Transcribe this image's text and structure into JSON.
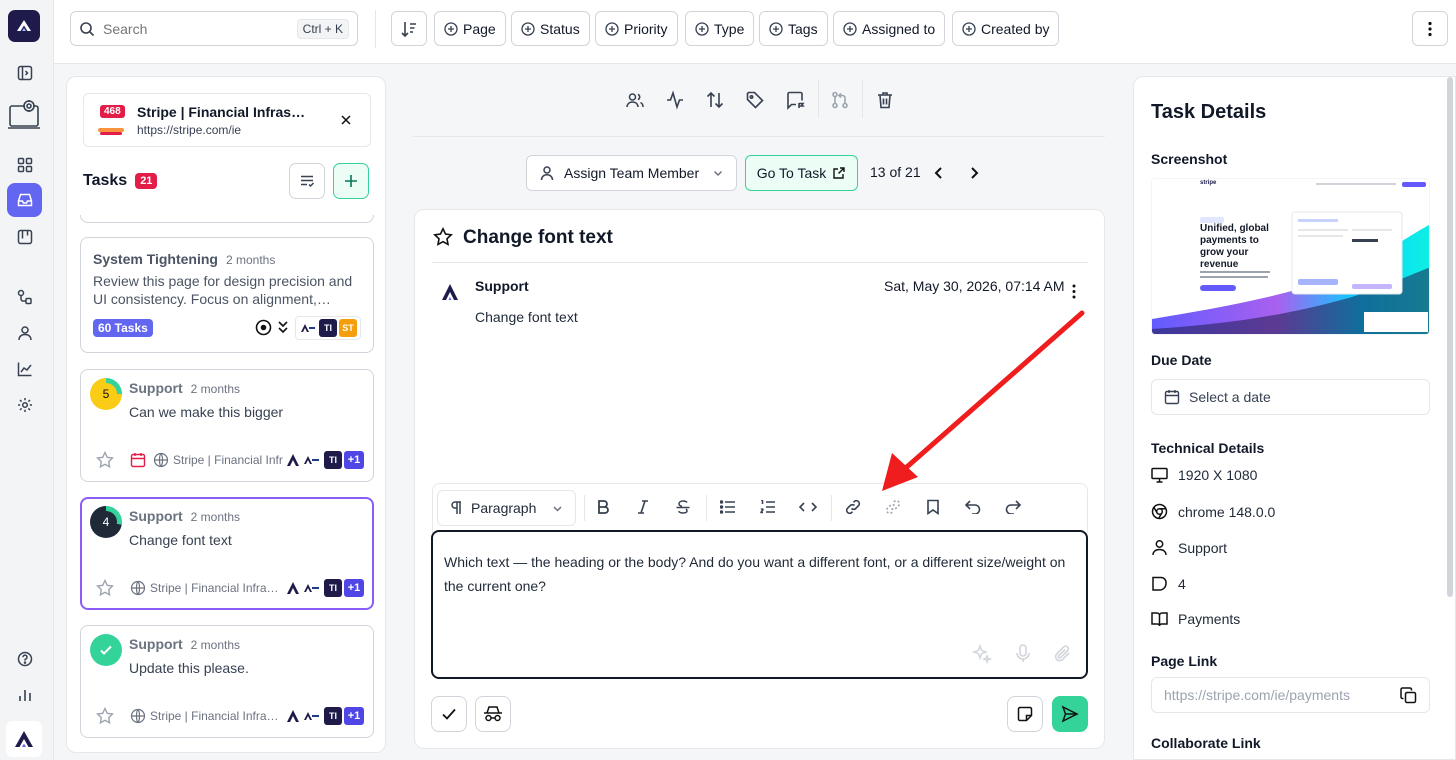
{
  "search": {
    "placeholder": "Search",
    "shortcut": "Ctrl + K"
  },
  "filters": [
    "Page",
    "Status",
    "Priority",
    "Type",
    "Tags",
    "Assigned to",
    "Created by"
  ],
  "site": {
    "badge": "468",
    "title": "Stripe | Financial Infras…",
    "url": "https://stripe.com/ie"
  },
  "tasks": {
    "label": "Tasks",
    "count": "21",
    "group": {
      "title": "System Tightening",
      "time": "2 months",
      "desc": "Review this page for design precision and UI consistency. Focus on alignment,…",
      "badge": "60 Tasks",
      "avatars": [
        "TI",
        "ST"
      ]
    },
    "items": [
      {
        "author": "Support",
        "time": "2 months",
        "text": "Can we make this bigger",
        "priority": "5",
        "site": "Stripe | Financial Infr",
        "av": "TI",
        "more": "+1"
      },
      {
        "author": "Support",
        "time": "2 months",
        "text": "Change font text",
        "priority": "4",
        "site": "Stripe | Financial Infra…",
        "av": "TI",
        "more": "+1"
      },
      {
        "author": "Support",
        "time": "2 months",
        "text": "Update this please.",
        "site": "Stripe | Financial Infra…",
        "av": "TI",
        "more": "+1"
      }
    ]
  },
  "nav": {
    "assign": "Assign Team Member",
    "goto": "Go To Task",
    "position": "13 of 21"
  },
  "task": {
    "title": "Change font text",
    "comment": {
      "author": "Support",
      "date": "Sat, May 30, 2026, 07:14 AM",
      "text": "Change font text"
    }
  },
  "editor": {
    "block_type": "Paragraph",
    "reply": "Which text — the heading or the body? And do you want a different font, or a different size/weight on the current one?"
  },
  "details": {
    "title": "Task Details",
    "screenshot_label": "Screenshot",
    "thumb": {
      "headline": "Unified, global payments to grow your revenue",
      "brand": "stripe"
    },
    "due_label": "Due Date",
    "due_placeholder": "Select a date",
    "tech_label": "Technical Details",
    "tech": {
      "resolution": "1920 X 1080",
      "browser": "chrome 148.0.0",
      "user": "Support",
      "priority": "4",
      "category": "Payments"
    },
    "page_link_label": "Page Link",
    "page_link": "https://stripe.com/ie/payments",
    "collab_label": "Collaborate Link"
  },
  "colors": {
    "accent": "#6366f1",
    "green": "#34d399",
    "red": "#e11d48",
    "dark": "#1e1b4b"
  }
}
